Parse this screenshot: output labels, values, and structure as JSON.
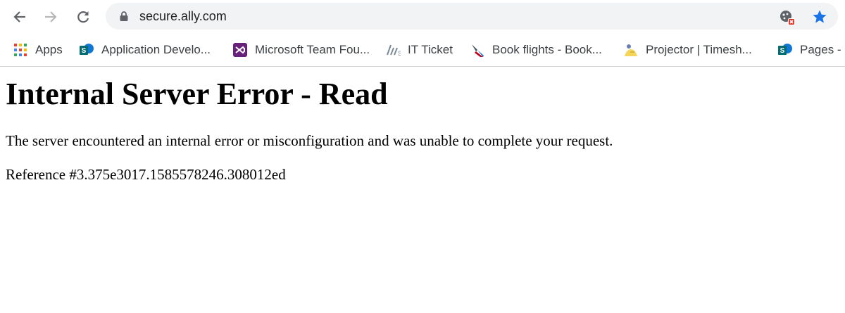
{
  "browser": {
    "url": "secure.ally.com",
    "icons": {
      "back": "arrow-left-icon",
      "forward": "arrow-right-icon",
      "reload": "reload-icon",
      "lock": "lock-icon",
      "extension": "blocked-content-icon",
      "bookmark": "star-icon"
    },
    "colors": {
      "star": "#1a73e8",
      "omnibox": "#f1f3f4",
      "forward_disabled": "#b8b8b8"
    }
  },
  "bookmarks": [
    {
      "label": "Apps",
      "icon": "apps-grid-icon"
    },
    {
      "label": "Application Develo...",
      "icon": "sharepoint-icon"
    },
    {
      "label": "Microsoft Team Fou...",
      "icon": "visual-studio-icon"
    },
    {
      "label": "IT Ticket",
      "icon": "servicenow-icon"
    },
    {
      "label": "Book flights - Book...",
      "icon": "american-airlines-icon"
    },
    {
      "label": "Projector | Timesh...",
      "icon": "projector-icon"
    },
    {
      "label": "Pages - C",
      "icon": "sharepoint-icon"
    }
  ],
  "page": {
    "title": "Internal Server Error - Read",
    "message": "The server encountered an internal error or misconfiguration and was unable to complete your request.",
    "reference": "Reference #3.375e3017.1585578246.308012ed"
  }
}
